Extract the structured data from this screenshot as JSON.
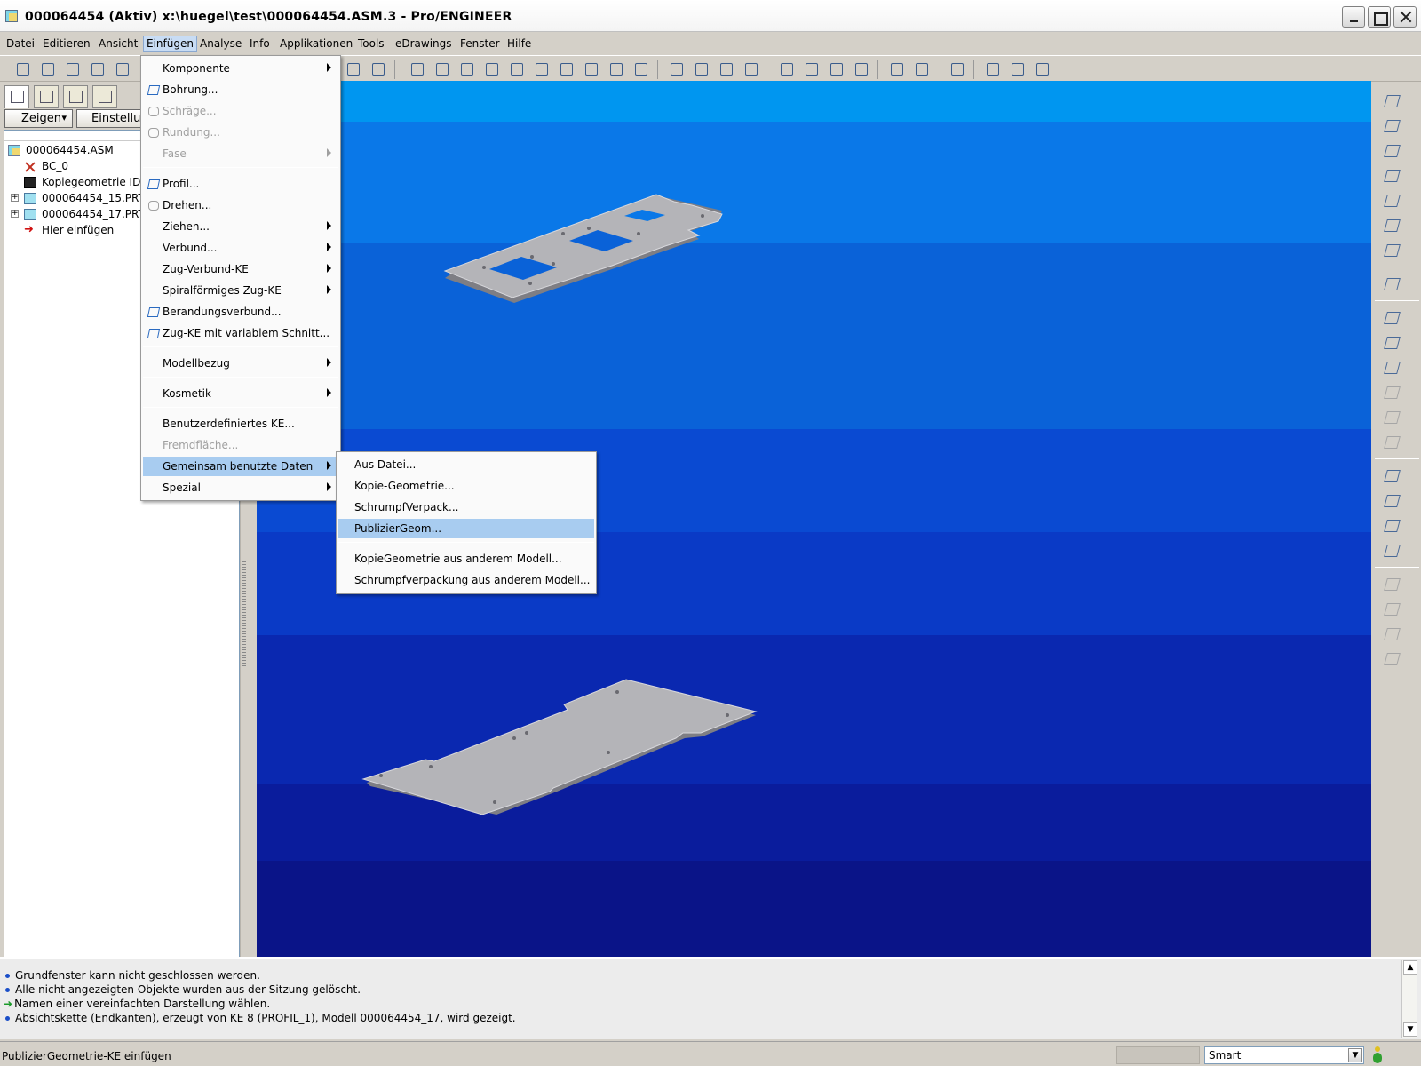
{
  "window": {
    "title": "000064454 (Aktiv) x:\\huegel\\test\\000064454.ASM.3 - Pro/ENGINEER"
  },
  "menubar": {
    "items": [
      "Datei",
      "Editieren",
      "Ansicht",
      "Einfügen",
      "Analyse",
      "Info",
      "Applikationen",
      "Tools",
      "eDrawings",
      "Fenster",
      "Hilfe"
    ],
    "active": "Einfügen"
  },
  "panel": {
    "show_button": "Zeigen",
    "settings_button": "Einstellungen",
    "tree": [
      {
        "label": "000064454.ASM",
        "icon": "assembly-icon"
      },
      {
        "label": "BC_0",
        "icon": "coordinate-system-icon"
      },
      {
        "label": "Kopiegeometrie ID",
        "icon": "copy-geometry-icon"
      },
      {
        "label": "000064454_15.PRT",
        "icon": "part-icon"
      },
      {
        "label": "000064454_17.PRT",
        "icon": "part-icon"
      },
      {
        "label": "Hier einfügen",
        "icon": "insert-here-arrow-icon"
      }
    ]
  },
  "insert_menu": {
    "items": [
      {
        "label": "Komponente",
        "submenu": true,
        "disabled": false
      },
      {
        "label": "Bohrung...",
        "submenu": false,
        "disabled": false
      },
      {
        "label": "Schräge...",
        "submenu": false,
        "disabled": true
      },
      {
        "label": "Rundung...",
        "submenu": false,
        "disabled": true
      },
      {
        "label": "Fase",
        "submenu": true,
        "disabled": true
      },
      {
        "label": "Profil...",
        "submenu": false,
        "disabled": false
      },
      {
        "label": "Drehen...",
        "submenu": false,
        "disabled": false
      },
      {
        "label": "Ziehen...",
        "submenu": true,
        "disabled": false
      },
      {
        "label": "Verbund...",
        "submenu": true,
        "disabled": false
      },
      {
        "label": "Zug-Verbund-KE",
        "submenu": true,
        "disabled": false
      },
      {
        "label": "Spiralförmiges Zug-KE",
        "submenu": true,
        "disabled": false
      },
      {
        "label": "Berandungsverbund...",
        "submenu": false,
        "disabled": false
      },
      {
        "label": "Zug-KE mit variablem Schnitt...",
        "submenu": false,
        "disabled": false
      },
      {
        "label": "Modellbezug",
        "submenu": true,
        "disabled": false
      },
      {
        "label": "Kosmetik",
        "submenu": true,
        "disabled": false
      },
      {
        "label": "Benutzerdefiniertes KE...",
        "submenu": false,
        "disabled": false
      },
      {
        "label": "Fremdfläche...",
        "submenu": false,
        "disabled": true
      },
      {
        "label": "Gemeinsam benutzte Daten",
        "submenu": true,
        "disabled": false,
        "selected": true
      },
      {
        "label": "Spezial",
        "submenu": true,
        "disabled": false
      }
    ]
  },
  "shared_data_menu": {
    "items": [
      {
        "label": "Aus Datei..."
      },
      {
        "label": "Kopie-Geometrie..."
      },
      {
        "label": "SchrumpfVerpack..."
      },
      {
        "label": "PublizierGeom...",
        "selected": true
      },
      {
        "label": "KopieGeometrie aus anderem Modell..."
      },
      {
        "label": "Schrumpfverpackung aus anderem Modell..."
      }
    ]
  },
  "messages": [
    {
      "text": "Grundfenster kann nicht geschlossen werden.",
      "kind": "info"
    },
    {
      "text": "Alle nicht angezeigten Objekte wurden aus der Sitzung gelöscht.",
      "kind": "info"
    },
    {
      "text": "Namen einer vereinfachten Darstellung wählen.",
      "kind": "prompt"
    },
    {
      "text": "Absichtskette (Endkanten), erzeugt von KE 8 (PROFIL_1), Modell 000064454_17, wird gezeigt.",
      "kind": "info"
    }
  ],
  "status": {
    "text": "PublizierGeometrie-KE einfügen",
    "filter": "Smart"
  },
  "colors": {
    "viewport_bands": [
      "#0096f0",
      "#0a7ae6",
      "#0a62d8",
      "#0a4ad0",
      "#0a3ac8",
      "#0a30b8",
      "#0a1ea0",
      "#0a148a"
    ],
    "part": "#b0b0b4",
    "menu_highlight": "#a8ccf0"
  }
}
